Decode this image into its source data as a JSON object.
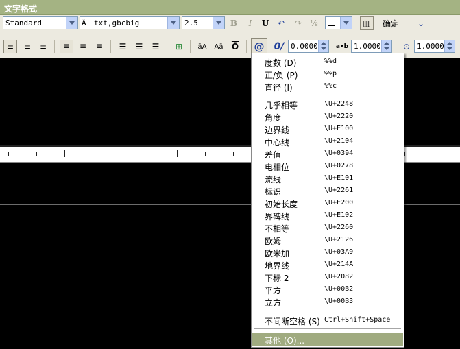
{
  "title": "文字格式",
  "row1": {
    "style": "Standard",
    "font": "txt,gbcbig",
    "height": "2.5",
    "bold": "B",
    "italic": "I",
    "underline": "U",
    "ok": "确定"
  },
  "row2": {
    "font_caps_a": "āA",
    "font_caps_b": "Aā",
    "at": "@",
    "oblique_label": "0/",
    "oblique": "0.0000",
    "tracking_label": "a•b",
    "tracking": "1.0000",
    "width_factor": "1.0000"
  },
  "menu": {
    "items": [
      {
        "label": "度数 (D)",
        "code": "%%d"
      },
      {
        "label": "正/负 (P)",
        "code": "%%p"
      },
      {
        "label": "直径 (I)",
        "code": "%%c"
      },
      {
        "label": "几乎相等",
        "code": "\\U+2248"
      },
      {
        "label": "角度",
        "code": "\\U+2220"
      },
      {
        "label": "边界线",
        "code": "\\U+E100"
      },
      {
        "label": "中心线",
        "code": "\\U+2104"
      },
      {
        "label": "差值",
        "code": "\\U+0394"
      },
      {
        "label": "电相位",
        "code": "\\U+0278"
      },
      {
        "label": "流线",
        "code": "\\U+E101"
      },
      {
        "label": "标识",
        "code": "\\U+2261"
      },
      {
        "label": "初始长度",
        "code": "\\U+E200"
      },
      {
        "label": "界碑线",
        "code": "\\U+E102"
      },
      {
        "label": "不相等",
        "code": "\\U+2260"
      },
      {
        "label": "欧姆",
        "code": "\\U+2126"
      },
      {
        "label": "欧米加",
        "code": "\\U+03A9"
      },
      {
        "label": "地界线",
        "code": "\\U+214A"
      },
      {
        "label": "下标 2",
        "code": "\\U+2082"
      },
      {
        "label": "平方",
        "code": "\\U+00B2"
      },
      {
        "label": "立方",
        "code": "\\U+00B3"
      },
      {
        "label": "不间断空格 (S)",
        "code": "Ctrl+Shift+Space"
      },
      {
        "label": "其他 (O)...",
        "code": ""
      }
    ]
  }
}
